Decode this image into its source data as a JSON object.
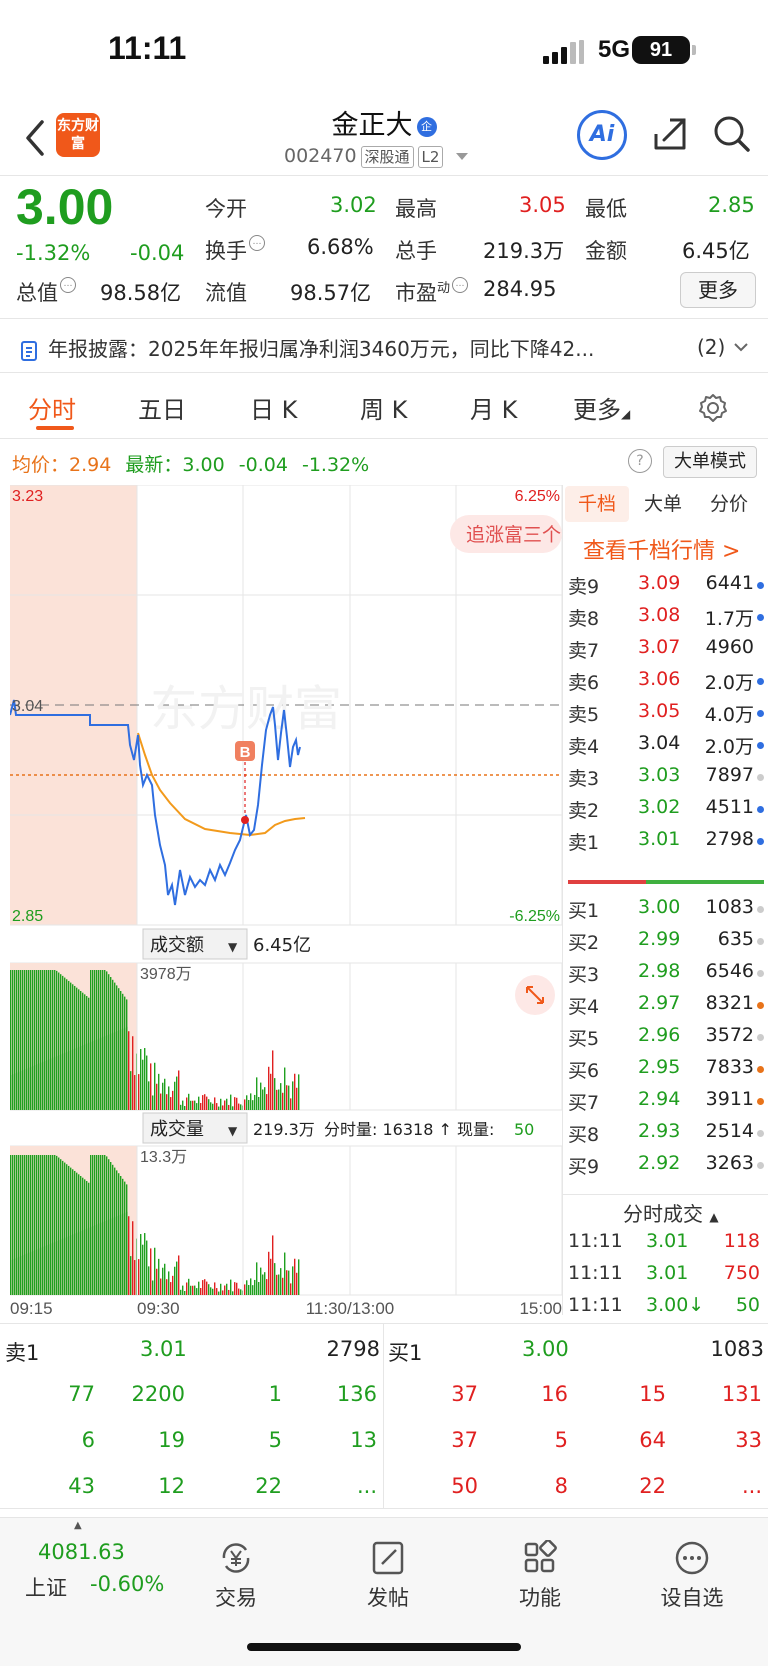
{
  "status": {
    "time": "11:11",
    "network": "5G",
    "battery": "91"
  },
  "header": {
    "logo_text": "东方财富",
    "name": "金正大",
    "name_badge": "企",
    "code": "002470",
    "tag1": "深股通",
    "tag2": "L2",
    "ai_label": "Ai"
  },
  "quote": {
    "price": "3.00",
    "change_pct": "-1.32%",
    "change": "-0.04",
    "open_label": "今开",
    "open": "3.02",
    "high_label": "最高",
    "high": "3.05",
    "low_label": "最低",
    "low": "2.85",
    "turnover_label": "换手",
    "turnover": "6.68%",
    "volume_label": "总手",
    "volume": "219.3万",
    "amount_label": "金额",
    "amount": "6.45亿",
    "mktcap_label": "总值",
    "mktcap": "98.58亿",
    "float_label": "流值",
    "float": "98.57亿",
    "pe_label": "市盈",
    "pe_sup": "动",
    "pe": "284.95",
    "more": "更多"
  },
  "notice": {
    "text": "年报披露：2025年年报归属净利润3460万元，同比下降42...",
    "count": "(2)"
  },
  "tabs": [
    "分时",
    "五日",
    "日 K",
    "周 K",
    "月 K",
    "更多"
  ],
  "legend": {
    "avg_label": "均价：",
    "avg": "2.94",
    "last_label": "最新：",
    "last": "3.00",
    "chg": "-0.04",
    "pct": "-1.32%",
    "big_mode": "大单模式"
  },
  "chart": {
    "y_top": "3.23",
    "y_mid": "3.04",
    "y_bot": "2.85",
    "pct_top": "6.25%",
    "pct_bot": "-6.25%",
    "promo": "追涨富三个",
    "marker": "B",
    "watermark": "东方财富",
    "amount_label": "成交额",
    "amount_total": "6.45亿",
    "amount_max": "3978万",
    "vol_label": "成交量",
    "vol_total": "219.3万",
    "vol_detail_label": "分时量: 16318 ↑ 现量:",
    "vol_now": "50",
    "vol_max": "13.3万",
    "x_labels": [
      "09:15",
      "09:30",
      "11:30/13:00",
      "15:00"
    ]
  },
  "orderbook": {
    "tabs": [
      "千档",
      "大单",
      "分价"
    ],
    "link": "查看千档行情 >",
    "sell": [
      {
        "n": "卖9",
        "p": "3.09",
        "v": "6441",
        "pc": "red",
        "dc": "#2f6ee0"
      },
      {
        "n": "卖8",
        "p": "3.08",
        "v": "1.7万",
        "pc": "red",
        "dc": "#2f6ee0"
      },
      {
        "n": "卖7",
        "p": "3.07",
        "v": "4960",
        "pc": "red",
        "dc": ""
      },
      {
        "n": "卖6",
        "p": "3.06",
        "v": "2.0万",
        "pc": "red",
        "dc": "#2f6ee0"
      },
      {
        "n": "卖5",
        "p": "3.05",
        "v": "4.0万",
        "pc": "red",
        "dc": "#2f6ee0"
      },
      {
        "n": "卖4",
        "p": "3.04",
        "v": "2.0万",
        "pc": "",
        "dc": "#2f6ee0"
      },
      {
        "n": "卖3",
        "p": "3.03",
        "v": "7897",
        "pc": "green",
        "dc": "#ccc"
      },
      {
        "n": "卖2",
        "p": "3.02",
        "v": "4511",
        "pc": "green",
        "dc": "#2f6ee0"
      },
      {
        "n": "卖1",
        "p": "3.01",
        "v": "2798",
        "pc": "green",
        "dc": "#2f6ee0"
      }
    ],
    "buy": [
      {
        "n": "买1",
        "p": "3.00",
        "v": "1083",
        "pc": "green",
        "dc": "#ccc"
      },
      {
        "n": "买2",
        "p": "2.99",
        "v": "635",
        "pc": "green",
        "dc": "#ccc"
      },
      {
        "n": "买3",
        "p": "2.98",
        "v": "6546",
        "pc": "green",
        "dc": "#ccc"
      },
      {
        "n": "买4",
        "p": "2.97",
        "v": "8321",
        "pc": "green",
        "dc": "#e8731a"
      },
      {
        "n": "买5",
        "p": "2.96",
        "v": "3572",
        "pc": "green",
        "dc": "#ccc"
      },
      {
        "n": "买6",
        "p": "2.95",
        "v": "7833",
        "pc": "green",
        "dc": "#e8731a"
      },
      {
        "n": "买7",
        "p": "2.94",
        "v": "3911",
        "pc": "green",
        "dc": "#e8731a"
      },
      {
        "n": "买8",
        "p": "2.93",
        "v": "2514",
        "pc": "green",
        "dc": "#ccc"
      },
      {
        "n": "买9",
        "p": "2.92",
        "v": "3263",
        "pc": "green",
        "dc": "#ccc"
      }
    ],
    "trades_title": "分时成交",
    "trades": [
      {
        "t": "11:11",
        "p": "3.01",
        "v": "118"
      },
      {
        "t": "11:11",
        "p": "3.01",
        "v": "750"
      },
      {
        "t": "11:11",
        "p": "3.00↓",
        "v": "50"
      }
    ]
  },
  "summary": {
    "sell_label": "卖1",
    "sell_price": "3.01",
    "sell_vol": "2798",
    "buy_label": "买1",
    "buy_price": "3.00",
    "buy_vol": "1083",
    "sell_queue": [
      [
        "77",
        "2200",
        "1",
        "136"
      ],
      [
        "6",
        "19",
        "5",
        "13"
      ],
      [
        "43",
        "12",
        "22",
        "..."
      ]
    ],
    "buy_queue": [
      [
        "37",
        "16",
        "15",
        "131"
      ],
      [
        "37",
        "5",
        "64",
        "33"
      ],
      [
        "50",
        "8",
        "22",
        "..."
      ]
    ]
  },
  "nav": {
    "index_value": "4081.63",
    "index_name": "上证",
    "index_pct": "-0.60%",
    "items": [
      "交易",
      "发帖",
      "功能",
      "设自选"
    ]
  }
}
